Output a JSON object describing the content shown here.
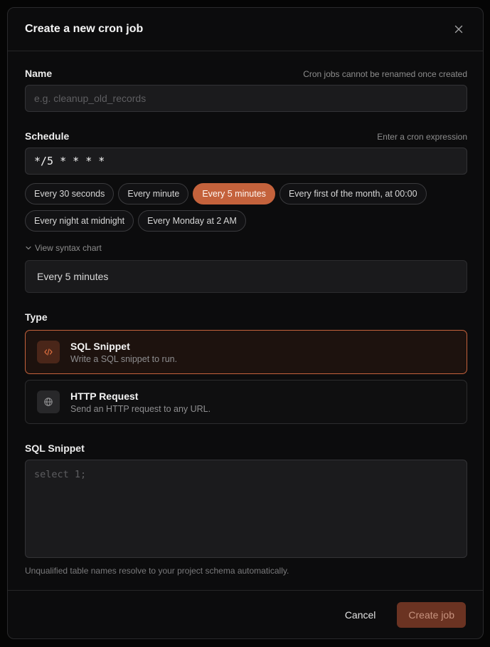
{
  "dialog": {
    "title": "Create a new cron job",
    "close_icon": "close-icon"
  },
  "name_field": {
    "label": "Name",
    "hint": "Cron jobs cannot be renamed once created",
    "placeholder": "e.g. cleanup_old_records",
    "value": ""
  },
  "schedule_field": {
    "label": "Schedule",
    "hint": "Enter a cron expression",
    "value": "*/5 * * * *",
    "presets": [
      {
        "label": "Every 30 seconds",
        "active": false
      },
      {
        "label": "Every minute",
        "active": false
      },
      {
        "label": "Every 5 minutes",
        "active": true
      },
      {
        "label": "Every first of the month, at 00:00",
        "active": false
      },
      {
        "label": "Every night at midnight",
        "active": false
      },
      {
        "label": "Every Monday at 2 AM",
        "active": false
      }
    ],
    "syntax_toggle": "View syntax chart",
    "description": "Every 5 minutes"
  },
  "type_field": {
    "label": "Type",
    "options": [
      {
        "title": "SQL Snippet",
        "description": "Write a SQL snippet to run.",
        "icon": "code-icon",
        "selected": true
      },
      {
        "title": "HTTP Request",
        "description": "Send an HTTP request to any URL.",
        "icon": "globe-icon",
        "selected": false
      }
    ]
  },
  "sql_field": {
    "label": "SQL Snippet",
    "placeholder": "select 1;",
    "note": "Unqualified table names resolve to your project schema automatically."
  },
  "footer": {
    "cancel_label": "Cancel",
    "create_label": "Create job"
  },
  "colors": {
    "accent": "#c4623c",
    "background": "#0c0c0d"
  }
}
